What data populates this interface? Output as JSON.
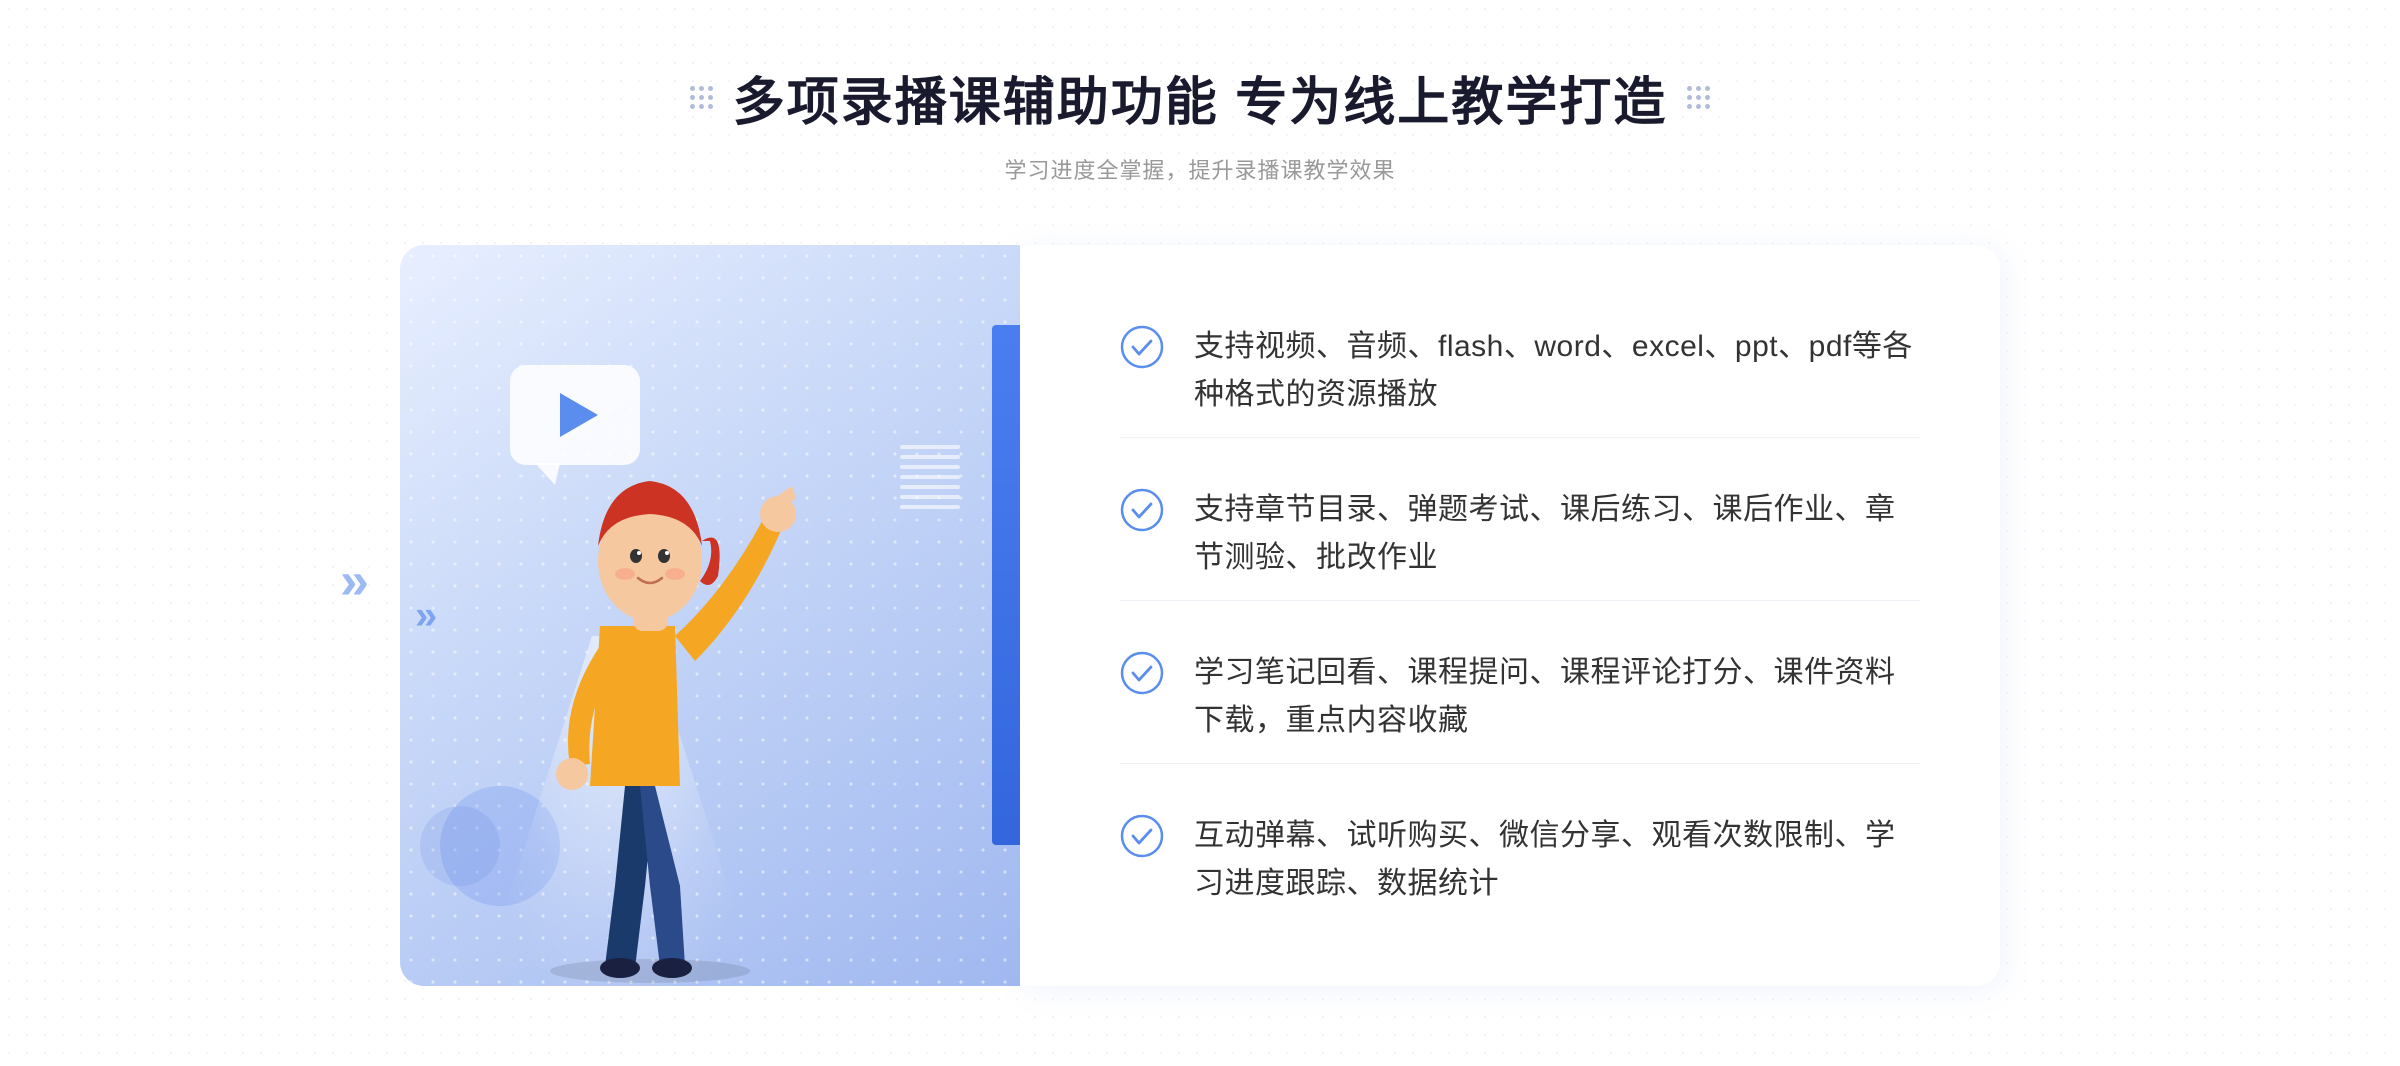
{
  "header": {
    "title": "多项录播课辅助功能 专为线上教学打造",
    "subtitle": "学习进度全掌握，提升录播课教学效果"
  },
  "features": [
    {
      "id": 1,
      "text": "支持视频、音频、flash、word、excel、ppt、pdf等各种格式的资源播放"
    },
    {
      "id": 2,
      "text": "支持章节目录、弹题考试、课后练习、课后作业、章节测验、批改作业"
    },
    {
      "id": 3,
      "text": "学习笔记回看、课程提问、课程评论打分、课件资料下载，重点内容收藏"
    },
    {
      "id": 4,
      "text": "互动弹幕、试听购买、微信分享、观看次数限制、学习进度跟踪、数据统计"
    }
  ],
  "decorations": {
    "chevron_symbol": "»",
    "check_color": "#5b8dee",
    "accent_color": "#4a7ef0",
    "title_color": "#1a1a2e",
    "text_color": "#333333",
    "subtitle_color": "#999999"
  }
}
